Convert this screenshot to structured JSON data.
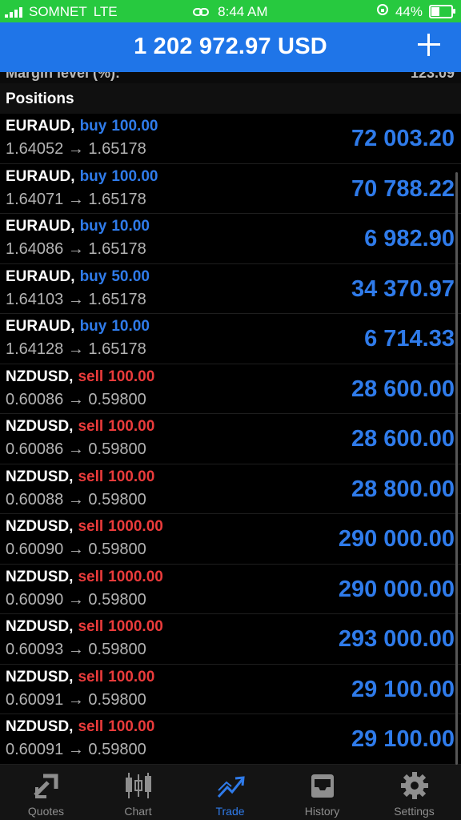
{
  "status_bar": {
    "carrier": "SOMNET",
    "network": "LTE",
    "time": "8:44 AM",
    "battery": "44%",
    "battery_level": 0.44
  },
  "header": {
    "title": "1 202 972.97 USD"
  },
  "peek_row": {
    "label": "Margin level (%):",
    "value": "123.09"
  },
  "section": {
    "title": "Positions"
  },
  "positions": [
    {
      "symbol": "EURAUD,",
      "side": "buy",
      "volume": "100.00",
      "prices": "1.64052 → 1.65178",
      "profit": "72 003.20"
    },
    {
      "symbol": "EURAUD,",
      "side": "buy",
      "volume": "100.00",
      "prices": "1.64071 → 1.65178",
      "profit": "70 788.22"
    },
    {
      "symbol": "EURAUD,",
      "side": "buy",
      "volume": "10.00",
      "prices": "1.64086 → 1.65178",
      "profit": "6 982.90"
    },
    {
      "symbol": "EURAUD,",
      "side": "buy",
      "volume": "50.00",
      "prices": "1.64103 → 1.65178",
      "profit": "34 370.97"
    },
    {
      "symbol": "EURAUD,",
      "side": "buy",
      "volume": "10.00",
      "prices": "1.64128 → 1.65178",
      "profit": "6 714.33"
    },
    {
      "symbol": "NZDUSD,",
      "side": "sell",
      "volume": "100.00",
      "prices": "0.60086 → 0.59800",
      "profit": "28 600.00"
    },
    {
      "symbol": "NZDUSD,",
      "side": "sell",
      "volume": "100.00",
      "prices": "0.60086 → 0.59800",
      "profit": "28 600.00"
    },
    {
      "symbol": "NZDUSD,",
      "side": "sell",
      "volume": "100.00",
      "prices": "0.60088 → 0.59800",
      "profit": "28 800.00"
    },
    {
      "symbol": "NZDUSD,",
      "side": "sell",
      "volume": "1000.00",
      "prices": "0.60090 → 0.59800",
      "profit": "290 000.00"
    },
    {
      "symbol": "NZDUSD,",
      "side": "sell",
      "volume": "1000.00",
      "prices": "0.60090 → 0.59800",
      "profit": "290 000.00"
    },
    {
      "symbol": "NZDUSD,",
      "side": "sell",
      "volume": "1000.00",
      "prices": "0.60093 → 0.59800",
      "profit": "293 000.00"
    },
    {
      "symbol": "NZDUSD,",
      "side": "sell",
      "volume": "100.00",
      "prices": "0.60091 → 0.59800",
      "profit": "29 100.00"
    },
    {
      "symbol": "NZDUSD,",
      "side": "sell",
      "volume": "100.00",
      "prices": "0.60091 → 0.59800",
      "profit": "29 100.00"
    }
  ],
  "tabs": [
    {
      "label": "Quotes",
      "icon": "quotes-icon",
      "active": false
    },
    {
      "label": "Chart",
      "icon": "chart-candles-icon",
      "active": false
    },
    {
      "label": "Trade",
      "icon": "trade-icon",
      "active": true
    },
    {
      "label": "History",
      "icon": "history-inbox-icon",
      "active": false
    },
    {
      "label": "Settings",
      "icon": "gear-icon",
      "active": false
    }
  ],
  "colors": {
    "status_bar": "#27c93f",
    "header": "#1f75e8",
    "buy": "#2f7bea",
    "sell": "#ea3b3b",
    "profit": "#2f7bea",
    "tab_active": "#2f7bea",
    "tab_inactive": "#8e8e8e"
  }
}
